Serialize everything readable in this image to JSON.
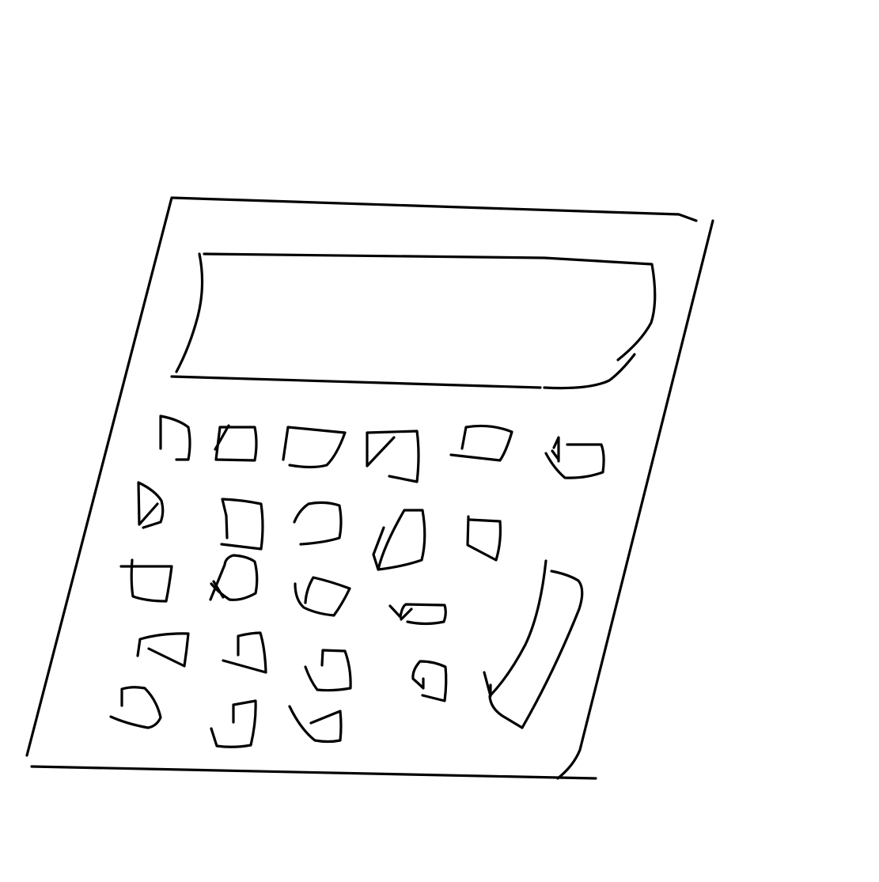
{
  "drawing": {
    "subject": "calculator",
    "style": "hand-drawn line sketch",
    "stroke_color": "#000000",
    "background_color": "#ffffff",
    "parts": [
      "body-outline",
      "display-screen",
      "keypad",
      "tall-equals-key"
    ],
    "key_rows": 5
  }
}
